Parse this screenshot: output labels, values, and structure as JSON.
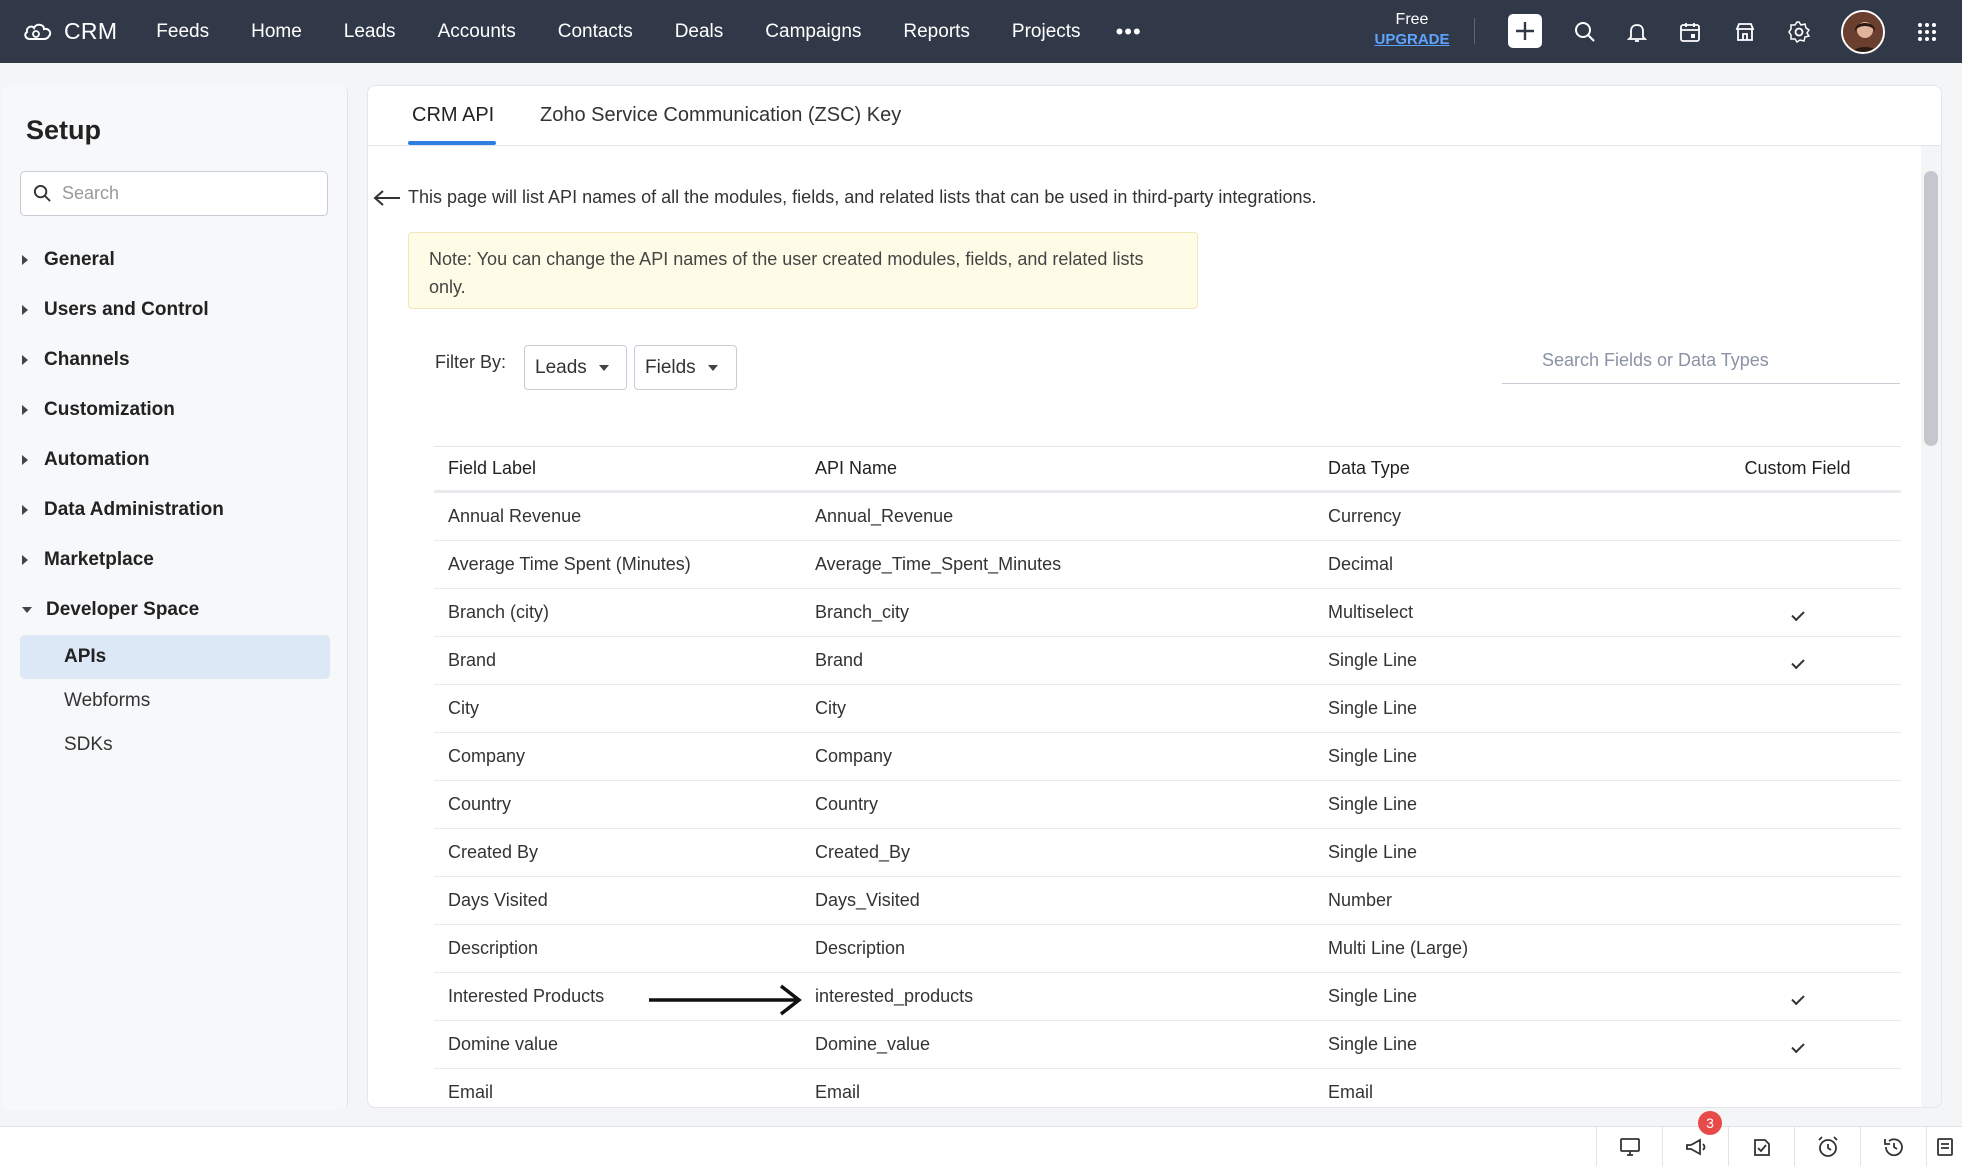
{
  "topbar": {
    "brand": "CRM",
    "nav": [
      "Feeds",
      "Home",
      "Leads",
      "Accounts",
      "Contacts",
      "Deals",
      "Campaigns",
      "Reports",
      "Projects"
    ],
    "more": "•••",
    "plan": "Free",
    "upgrade": "UPGRADE"
  },
  "sidebar": {
    "title": "Setup",
    "search_placeholder": "Search",
    "items": [
      "General",
      "Users and Control",
      "Channels",
      "Customization",
      "Automation",
      "Data Administration",
      "Marketplace",
      "Developer Space"
    ],
    "sub_items": [
      "APIs",
      "Webforms",
      "SDKs"
    ],
    "active_sub": "APIs"
  },
  "main": {
    "tabs": [
      "CRM API",
      "Zoho Service Communication (ZSC) Key"
    ],
    "intro": "This page will list API names of all the modules, fields, and related lists that can be used in third-party integrations.",
    "note": "Note: You can change the API names of the user created modules, fields, and related lists only.",
    "filter_label": "Filter By:",
    "module_filter": "Leads",
    "type_filter": "Fields",
    "search_placeholder": "Search Fields or Data Types",
    "columns": [
      "Field Label",
      "API Name",
      "Data Type",
      "Custom Field"
    ],
    "rows": [
      {
        "label": "Annual Revenue",
        "api": "Annual_Revenue",
        "type": "Currency",
        "custom": false
      },
      {
        "label": "Average Time Spent (Minutes)",
        "api": "Average_Time_Spent_Minutes",
        "type": "Decimal",
        "custom": false
      },
      {
        "label": "Branch (city)",
        "api": "Branch_city",
        "type": "Multiselect",
        "custom": true
      },
      {
        "label": "Brand",
        "api": "Brand",
        "type": "Single Line",
        "custom": true
      },
      {
        "label": "City",
        "api": "City",
        "type": "Single Line",
        "custom": false
      },
      {
        "label": "Company",
        "api": "Company",
        "type": "Single Line",
        "custom": false
      },
      {
        "label": "Country",
        "api": "Country",
        "type": "Single Line",
        "custom": false
      },
      {
        "label": "Created By",
        "api": "Created_By",
        "type": "Single Line",
        "custom": false
      },
      {
        "label": "Days Visited",
        "api": "Days_Visited",
        "type": "Number",
        "custom": false
      },
      {
        "label": "Description",
        "api": "Description",
        "type": "Multi Line (Large)",
        "custom": false
      },
      {
        "label": "Interested Products",
        "api": "interested_products",
        "type": "Single Line",
        "custom": true
      },
      {
        "label": "Domine value",
        "api": "Domine_value",
        "type": "Single Line",
        "custom": true
      },
      {
        "label": "Email",
        "api": "Email",
        "type": "Email",
        "custom": false
      }
    ]
  },
  "bottom_bar": {
    "notification_count": "3",
    "icons": [
      "screen-share-icon",
      "announcement-icon",
      "task-icon",
      "alarm-icon",
      "history-icon",
      "notes-icon"
    ]
  },
  "colors": {
    "topbar": "#313949",
    "accent": "#2f7de1",
    "note_bg": "#fefbe6",
    "active_item": "#dde8f6",
    "badge": "#e84a4a"
  }
}
